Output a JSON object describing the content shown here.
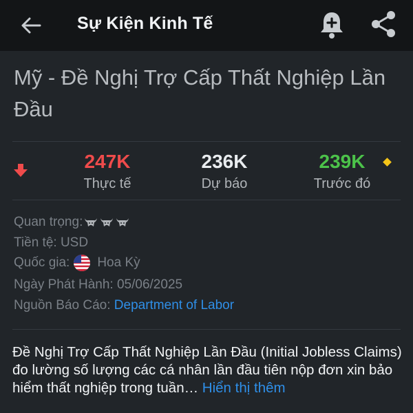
{
  "header": {
    "title": "Sự Kiện Kinh Tế"
  },
  "event": {
    "title": "Mỹ - Đề Nghị Trợ Cấp Thất Nghiệp Lần Đầu"
  },
  "stats": {
    "actual": {
      "value": "247K",
      "label": "Thực tế",
      "color": "#ef4b4b"
    },
    "forecast": {
      "value": "236K",
      "label": "Dự báo",
      "color": "#e9ecef"
    },
    "previous": {
      "value": "239K",
      "label": "Trước đó",
      "color": "#4cc24a"
    },
    "trend_icon": "down-arrow-icon",
    "revised_icon": "diamond-icon"
  },
  "info": {
    "importance_label": "Quan trọng:",
    "importance_level": 3,
    "currency_label": "Tiền tệ:",
    "currency_value": "USD",
    "country_label": "Quốc gia:",
    "country_value": "Hoa Kỳ",
    "release_date_label": "Ngày Phát Hành:",
    "release_date_value": "05/06/2025",
    "source_label": "Nguồn Báo Cáo:",
    "source_value": "Department of Labor"
  },
  "description": {
    "text": "Đề Nghị Trợ Cấp Thất Nghiệp Lần Đầu (Initial Jobless Claims) đo lường số lượng các cá nhân lần đầu tiên nộp đơn xin bảo hiểm thất nghiệp trong tuần…",
    "show_more": "Hiển thị thêm"
  }
}
